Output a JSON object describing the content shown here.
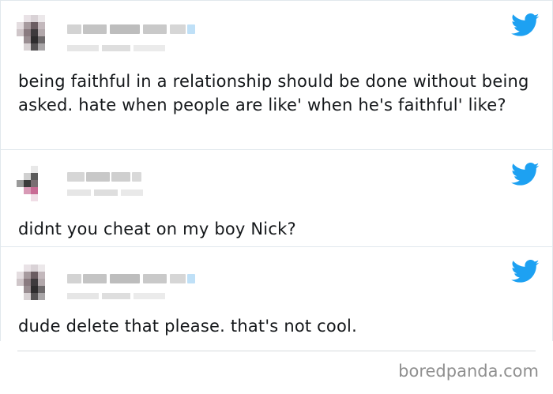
{
  "tweets": [
    {
      "text": "being faithful in a relationship should be done without being asked. hate when people are like' when he's faithful' like?"
    },
    {
      "text": "didnt you cheat on my boy Nick?"
    },
    {
      "text": "dude delete that please. that's not cool."
    }
  ],
  "watermark": "boredpanda.com",
  "colors": {
    "twitter_blue": "#1da1f2",
    "border": "#e1e8ed",
    "text": "#14171a"
  },
  "icons": {
    "tweet_source": "twitter-bird-icon"
  }
}
